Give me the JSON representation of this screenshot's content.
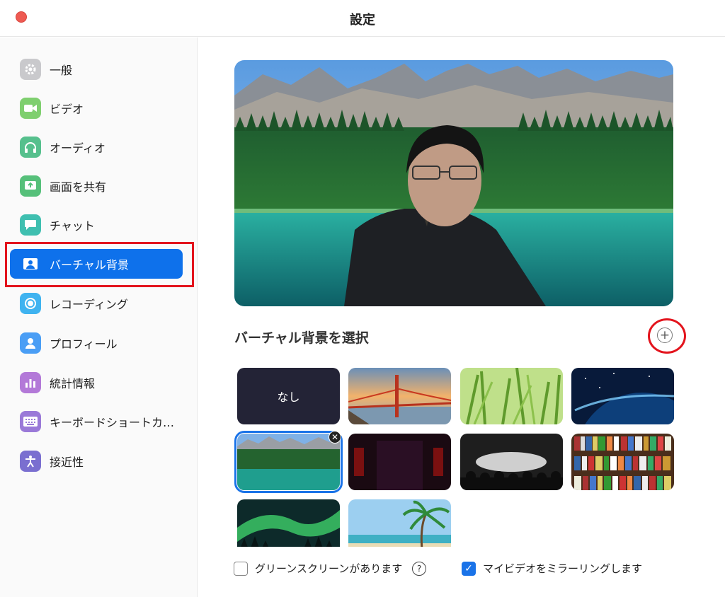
{
  "window": {
    "title": "設定"
  },
  "sidebar": {
    "items": [
      {
        "label": "一般",
        "icon": "gear-icon",
        "color": "#c9c9cc"
      },
      {
        "label": "ビデオ",
        "icon": "video-camera-icon",
        "color": "#7fcf6f"
      },
      {
        "label": "オーディオ",
        "icon": "headphones-icon",
        "color": "#56c08d"
      },
      {
        "label": "画面を共有",
        "icon": "share-screen-icon",
        "color": "#56c07a"
      },
      {
        "label": "チャット",
        "icon": "chat-bubble-icon",
        "color": "#3fbfb0"
      },
      {
        "label": "バーチャル背景",
        "icon": "person-background-icon",
        "color": "#0e71eb",
        "active": true
      },
      {
        "label": "レコーディング",
        "icon": "record-icon",
        "color": "#3fb3f0"
      },
      {
        "label": "プロフィール",
        "icon": "profile-icon",
        "color": "#4a9ef5"
      },
      {
        "label": "統計情報",
        "icon": "stats-icon",
        "color": "#b379d8"
      },
      {
        "label": "キーボードショートカ…",
        "icon": "keyboard-icon",
        "color": "#9a79d8"
      },
      {
        "label": "接近性",
        "icon": "accessibility-icon",
        "color": "#7a6fd0"
      }
    ]
  },
  "main": {
    "section_title": "バーチャル背景を選択",
    "none_label": "なし",
    "thumbnails": [
      "none",
      "golden-gate-bridge",
      "grass",
      "earth-from-space",
      "mountain-lake",
      "dark-stage",
      "concert-crowd",
      "bookshelf",
      "aurora",
      "tropical-beach"
    ],
    "selected_thumbnail": "mountain-lake",
    "green_screen_label": "グリーンスクリーンがあります",
    "green_screen_checked": false,
    "mirror_label": "マイビデオをミラーリングします",
    "mirror_checked": true
  },
  "colors": {
    "accent": "#0e71eb",
    "annotation": "#e3141d"
  }
}
